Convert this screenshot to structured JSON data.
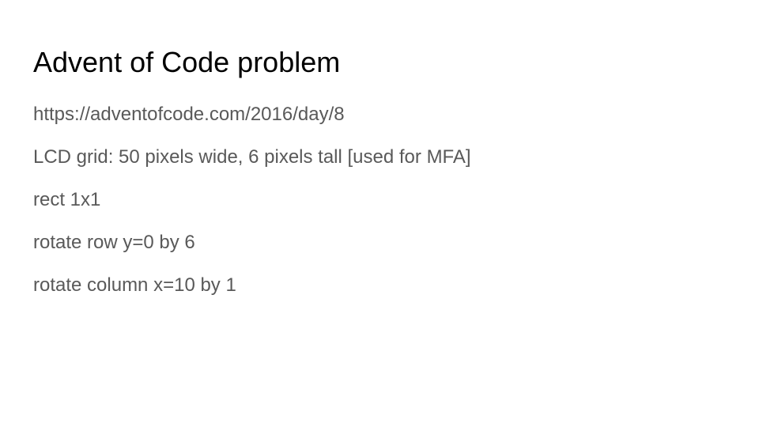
{
  "slide": {
    "title": "Advent of Code problem",
    "lines": [
      "https://adventofcode.com/2016/day/8",
      "LCD grid: 50 pixels wide, 6 pixels tall [used for MFA]",
      "rect 1x1",
      "rotate row y=0 by 6",
      "rotate column x=10 by 1"
    ]
  },
  "colors": {
    "title": "#000000",
    "body_text": "#595959",
    "background": "#ffffff"
  }
}
